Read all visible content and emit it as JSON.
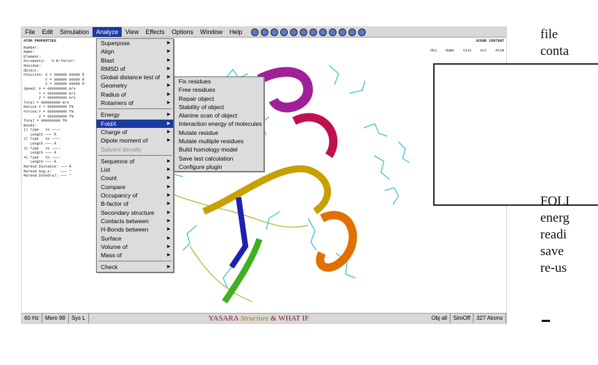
{
  "menubar": {
    "items": [
      "File",
      "Edit",
      "Simulation",
      "Analyze",
      "View",
      "Effects",
      "Options",
      "Window",
      "Help"
    ],
    "active": "Analyze"
  },
  "left_panel": {
    "title": "ATOM PROPERTIES",
    "rows": [
      "Number:",
      "Name:",
      "Element:",
      "Occupancy:   % B-factor:",
      "Residue:",
      "Object:",
      "",
      "Position: X = 000000 00000 Å",
      "          Y = 000000 00000 Å",
      "          Z = 000000 00000 Å",
      "",
      "Speed: X = 000000000 m/s",
      "       Y = 000000000 m/s",
      "       Z = 000000000 m/s",
      "Total = 000000000 m/s",
      "",
      "Native X = 000000000 fN",
      "Forces:Y = 000000000 fN",
      "       Z = 000000000 fN",
      "Total = 000000000 fN",
      "",
      "Bonds:",
      "1) Type   to ———:",
      "   Length ——— Å",
      "2) Type   to ———:",
      "   Length ——— Å",
      "3) Type   to ———:",
      "   Length ——— Å",
      "4) Type   to ———:",
      "   Length ——— Å",
      "",
      "Marked Distance: ——— Å",
      "Marked Ang.e:    ——— °",
      "Marked Dihedral: ——— °"
    ]
  },
  "right_panel": {
    "title": "SCENE CONTENT",
    "columns": [
      "Obj",
      "Name",
      "Visi",
      "Act",
      "Atom"
    ]
  },
  "analyze_menu": {
    "items": [
      {
        "label": "Superpose",
        "arrow": true
      },
      {
        "label": "Align",
        "arrow": true
      },
      {
        "label": "Blast",
        "arrow": true
      },
      {
        "label": "RMSD of",
        "arrow": true
      },
      {
        "label": "Global distance test of",
        "arrow": true
      },
      {
        "label": "Geometry",
        "arrow": true
      },
      {
        "label": "Radius of",
        "arrow": true
      },
      {
        "label": "Rotamers of",
        "arrow": true
      },
      {
        "sep": true
      },
      {
        "label": "Energy",
        "arrow": true
      },
      {
        "label": "FoldX",
        "arrow": true,
        "selected": true
      },
      {
        "label": "Charge of",
        "arrow": true
      },
      {
        "label": "Dipole moment of",
        "arrow": true
      },
      {
        "label": "Solvent density",
        "disabled": true
      },
      {
        "sep": true
      },
      {
        "label": "Sequence of",
        "arrow": true
      },
      {
        "label": "List",
        "arrow": true
      },
      {
        "label": "Count",
        "arrow": true
      },
      {
        "label": "Compare",
        "arrow": true
      },
      {
        "label": "Occupancy of",
        "arrow": true
      },
      {
        "label": "B-factor of",
        "arrow": true
      },
      {
        "label": "Secondary structure",
        "arrow": true
      },
      {
        "label": "Contacts between",
        "arrow": true
      },
      {
        "label": "H-Bonds between",
        "arrow": true
      },
      {
        "label": "Surface",
        "arrow": true
      },
      {
        "label": "Volume of",
        "arrow": true
      },
      {
        "label": "Mass of",
        "arrow": true
      },
      {
        "sep": true
      },
      {
        "label": "Check",
        "arrow": true
      }
    ]
  },
  "foldx_menu": {
    "items": [
      "Fix residues",
      "Free residues",
      "Repair object",
      "Stability of object",
      "Alanine scan of object",
      "Interaction energy of molecules",
      "Mutate residue",
      "Mutate multiple residues",
      "Build homology model",
      "Save last calculation",
      "Configure plugin"
    ]
  },
  "statusbar": {
    "fps": "60 Hz",
    "mem": "Mem 98",
    "sys": "Sys L",
    "brand_a": "YASARA",
    "brand_b": "Structure",
    "brand_c": "& WHAT IF",
    "obj": "Obj all",
    "sim": "SimOff",
    "atoms": "327 Atoms"
  },
  "slide_text": {
    "lines": [
      "file",
      "conta",
      "",
      "",
      "",
      "",
      "",
      "",
      "",
      "",
      "FOLI",
      "energ",
      "readi",
      "save",
      "re-us"
    ]
  },
  "colors": {
    "menu_highlight": "#1a3aa0",
    "brand": "#8a1a1a"
  }
}
